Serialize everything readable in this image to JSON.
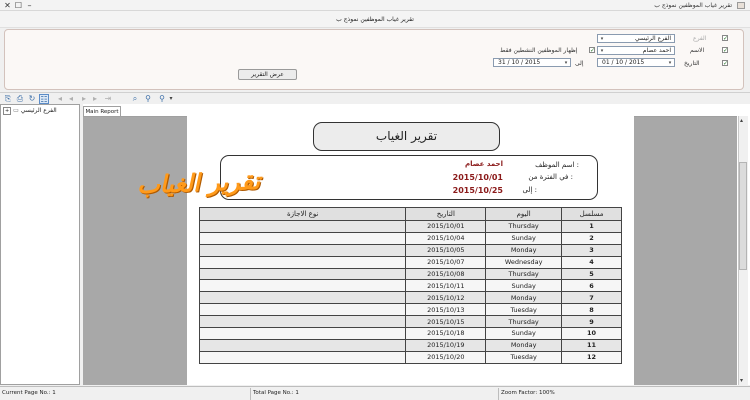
{
  "window": {
    "title": "تقرير غياب الموظفين نموذج ب"
  },
  "subtitle": "تقرير غياب الموظفين نموذج ب",
  "filters": {
    "branch": {
      "label": "الفرع",
      "value": "الفرع الرئيسي"
    },
    "name": {
      "label": "الاسم",
      "value": "احمد عصام"
    },
    "active_only": {
      "label": "إظهار الموظفين النشطين فقط"
    },
    "date": {
      "label": "التاريخ",
      "from": "01 / 10 / 2015",
      "to_label": "إلى",
      "to": "31 / 10 / 2015"
    },
    "show_button": "عرض التقرير"
  },
  "tree": {
    "root": "الفرع الرئيسي"
  },
  "tab": "Main Report",
  "report": {
    "title": "تقرير الغياب",
    "employee_label": "اسم الموظف :",
    "employee": "احمد عصام",
    "from_label": "في الفترة من :",
    "from": "2015/10/01",
    "to_label": "إلى :",
    "to": "2015/10/25",
    "watermark": "تقرير الغياب",
    "columns": {
      "serial": "مسلسل",
      "day": "اليوم",
      "date": "التاريخ",
      "leave": "نوع الاجازة"
    },
    "rows": [
      {
        "n": "1",
        "day": "Thursday",
        "date": "2015/10/01"
      },
      {
        "n": "2",
        "day": "Sunday",
        "date": "2015/10/04"
      },
      {
        "n": "3",
        "day": "Monday",
        "date": "2015/10/05"
      },
      {
        "n": "4",
        "day": "Wednesday",
        "date": "2015/10/07"
      },
      {
        "n": "5",
        "day": "Thursday",
        "date": "2015/10/08"
      },
      {
        "n": "6",
        "day": "Sunday",
        "date": "2015/10/11"
      },
      {
        "n": "7",
        "day": "Monday",
        "date": "2015/10/12"
      },
      {
        "n": "8",
        "day": "Tuesday",
        "date": "2015/10/13"
      },
      {
        "n": "9",
        "day": "Thursday",
        "date": "2015/10/15"
      },
      {
        "n": "10",
        "day": "Sunday",
        "date": "2015/10/18"
      },
      {
        "n": "11",
        "day": "Monday",
        "date": "2015/10/19"
      },
      {
        "n": "12",
        "day": "Tuesday",
        "date": "2015/10/20"
      }
    ]
  },
  "status": {
    "current_page": "Current Page No.: 1",
    "total_page": "Total Page No.: 1",
    "zoom": "Zoom Factor: 100%"
  },
  "icons": [
    "export-icon",
    "print-icon",
    "refresh-icon",
    "tree-toggle-icon",
    "first-page-icon",
    "prev-page-icon",
    "next-page-icon",
    "last-page-icon",
    "goto-page-icon",
    "search-icon",
    "zoom-icon"
  ]
}
